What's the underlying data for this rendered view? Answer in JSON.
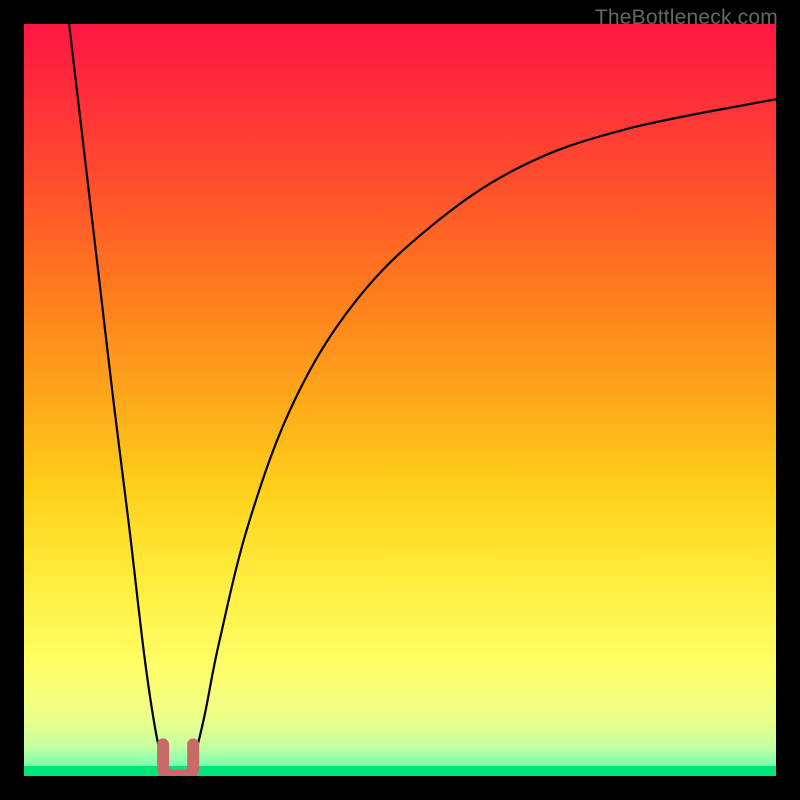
{
  "watermark": "TheBottleneck.com",
  "chart_data": {
    "type": "line",
    "title": "",
    "xlabel": "",
    "ylabel": "",
    "xlim": [
      0,
      100
    ],
    "ylim": [
      0,
      100
    ],
    "series": [
      {
        "name": "left-curve",
        "x": [
          6,
          8,
          10,
          12,
          14,
          16,
          17.5,
          18.5,
          19.5
        ],
        "values": [
          100,
          83,
          66,
          49,
          33,
          16,
          6,
          2,
          0
        ]
      },
      {
        "name": "right-curve",
        "x": [
          21.5,
          22.5,
          24,
          26,
          30,
          36,
          44,
          54,
          66,
          80,
          100
        ],
        "values": [
          0,
          2,
          8,
          18,
          34,
          50,
          63,
          73,
          81,
          86,
          90
        ]
      }
    ],
    "marker": {
      "shape": "U",
      "color": "#C96A6A",
      "x_center": 20.5,
      "y_center": 2,
      "width": 4
    },
    "gradient": {
      "stops": [
        {
          "pos": 0.0,
          "color": "#FF1744"
        },
        {
          "pos": 0.08,
          "color": "#FF2A3C"
        },
        {
          "pos": 0.2,
          "color": "#FF4B2E"
        },
        {
          "pos": 0.35,
          "color": "#FF7A1E"
        },
        {
          "pos": 0.5,
          "color": "#FFA81A"
        },
        {
          "pos": 0.62,
          "color": "#FFD11A"
        },
        {
          "pos": 0.73,
          "color": "#FFEB3B"
        },
        {
          "pos": 0.85,
          "color": "#FFFF66"
        },
        {
          "pos": 0.92,
          "color": "#EEFF88"
        },
        {
          "pos": 0.96,
          "color": "#C8FFA0"
        },
        {
          "pos": 0.985,
          "color": "#7CFFB0"
        },
        {
          "pos": 1.0,
          "color": "#00E676"
        }
      ]
    }
  }
}
